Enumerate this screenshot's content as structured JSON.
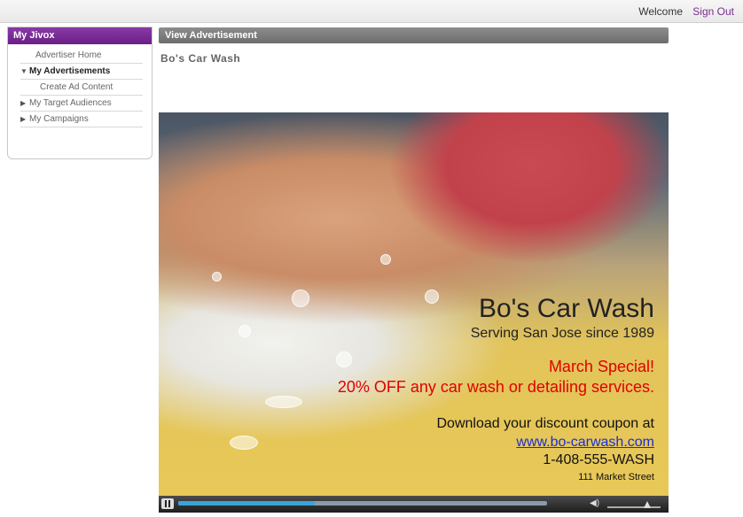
{
  "header": {
    "welcome": "Welcome",
    "sign_out": "Sign Out"
  },
  "sidebar": {
    "title": "My Jivox",
    "items": [
      {
        "label": "Advertiser Home"
      },
      {
        "label": "My Advertisements"
      },
      {
        "label": "Create Ad Content"
      },
      {
        "label": "My Target Audiences"
      },
      {
        "label": "My Campaigns"
      }
    ]
  },
  "main": {
    "section_title": "View Advertisement",
    "ad_name": "Bo's Car Wash"
  },
  "ad": {
    "name": "Bo's Car Wash",
    "serving": "Serving San Jose since 1989",
    "special_line1": "March Special!",
    "special_line2": "20% OFF any car wash or detailing services.",
    "download": "Download your discount coupon at",
    "url": "www.bo-carwash.com",
    "phone": "1-408-555-WASH",
    "street": "111 Market Street"
  },
  "player": {
    "progress": 0.37,
    "volume": 0.75,
    "icons": {
      "pause": "pause-icon",
      "volume": "volume-icon"
    }
  },
  "colors": {
    "accent": "#6a1f86",
    "link": "#1a2fd1",
    "special": "#e00000"
  }
}
